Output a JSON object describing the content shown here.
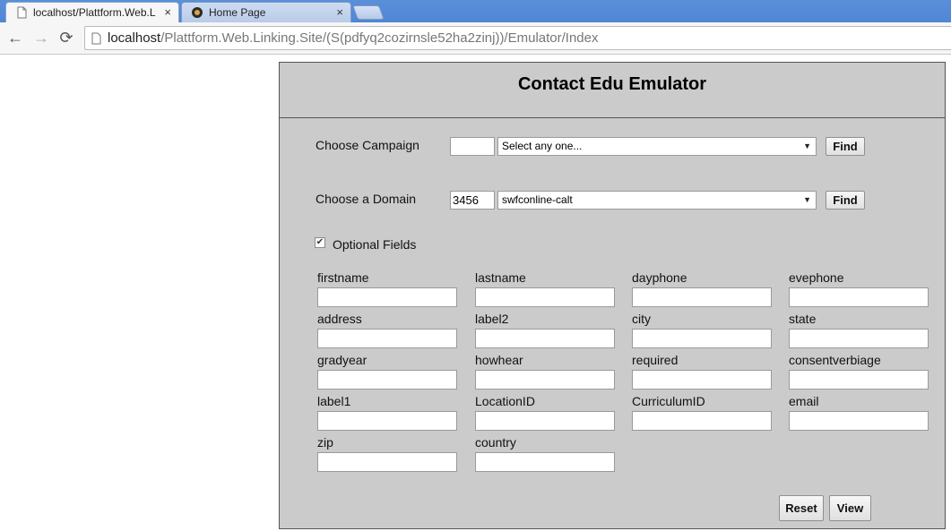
{
  "browser": {
    "tabs": [
      {
        "title": "localhost/Plattform.Web.L",
        "close": "×"
      },
      {
        "title": "Home Page",
        "close": "×"
      }
    ],
    "nav": {
      "back": "←",
      "forward": "→",
      "reload": "⟳"
    },
    "url_host": "localhost",
    "url_path": "/Plattform.Web.Linking.Site/(S(pdfyq2cozirnsle52ha2zinj))/Emulator/Index"
  },
  "page": {
    "title": "Contact Edu Emulator",
    "campaign": {
      "label": "Choose Campaign",
      "id_value": "",
      "select_value": "Select any one...",
      "find_label": "Find"
    },
    "domain": {
      "label": "Choose a Domain",
      "id_value": "3456",
      "select_value": "swfconline-calt",
      "find_label": "Find"
    },
    "optional": {
      "checked": true,
      "check_glyph": "✔",
      "label": "Optional Fields"
    },
    "fields": [
      {
        "label": "firstname",
        "value": ""
      },
      {
        "label": "lastname",
        "value": ""
      },
      {
        "label": "dayphone",
        "value": ""
      },
      {
        "label": "evephone",
        "value": ""
      },
      {
        "label": "address",
        "value": ""
      },
      {
        "label": "label2",
        "value": ""
      },
      {
        "label": "city",
        "value": ""
      },
      {
        "label": "state",
        "value": ""
      },
      {
        "label": "gradyear",
        "value": ""
      },
      {
        "label": "howhear",
        "value": ""
      },
      {
        "label": "required",
        "value": ""
      },
      {
        "label": "consentverbiage",
        "value": ""
      },
      {
        "label": "label1",
        "value": ""
      },
      {
        "label": "LocationID",
        "value": ""
      },
      {
        "label": "CurriculumID",
        "value": ""
      },
      {
        "label": "email",
        "value": ""
      },
      {
        "label": "zip",
        "value": ""
      },
      {
        "label": "country",
        "value": ""
      }
    ],
    "reset_label": "Reset",
    "view_label": "View"
  }
}
